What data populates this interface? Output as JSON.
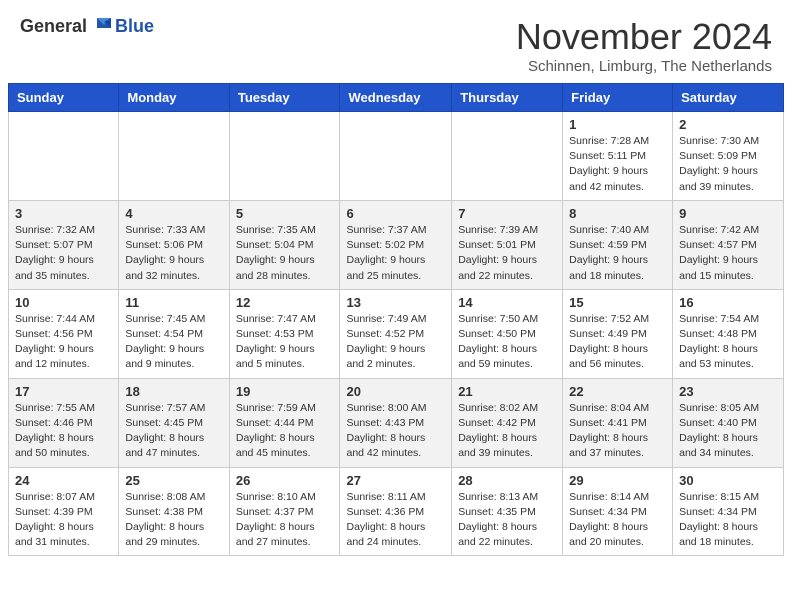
{
  "header": {
    "logo": {
      "general": "General",
      "blue": "Blue"
    },
    "title": "November 2024",
    "subtitle": "Schinnen, Limburg, The Netherlands"
  },
  "columns": [
    "Sunday",
    "Monday",
    "Tuesday",
    "Wednesday",
    "Thursday",
    "Friday",
    "Saturday"
  ],
  "weeks": [
    [
      {
        "day": "",
        "detail": ""
      },
      {
        "day": "",
        "detail": ""
      },
      {
        "day": "",
        "detail": ""
      },
      {
        "day": "",
        "detail": ""
      },
      {
        "day": "",
        "detail": ""
      },
      {
        "day": "1",
        "detail": "Sunrise: 7:28 AM\nSunset: 5:11 PM\nDaylight: 9 hours\nand 42 minutes."
      },
      {
        "day": "2",
        "detail": "Sunrise: 7:30 AM\nSunset: 5:09 PM\nDaylight: 9 hours\nand 39 minutes."
      }
    ],
    [
      {
        "day": "3",
        "detail": "Sunrise: 7:32 AM\nSunset: 5:07 PM\nDaylight: 9 hours\nand 35 minutes."
      },
      {
        "day": "4",
        "detail": "Sunrise: 7:33 AM\nSunset: 5:06 PM\nDaylight: 9 hours\nand 32 minutes."
      },
      {
        "day": "5",
        "detail": "Sunrise: 7:35 AM\nSunset: 5:04 PM\nDaylight: 9 hours\nand 28 minutes."
      },
      {
        "day": "6",
        "detail": "Sunrise: 7:37 AM\nSunset: 5:02 PM\nDaylight: 9 hours\nand 25 minutes."
      },
      {
        "day": "7",
        "detail": "Sunrise: 7:39 AM\nSunset: 5:01 PM\nDaylight: 9 hours\nand 22 minutes."
      },
      {
        "day": "8",
        "detail": "Sunrise: 7:40 AM\nSunset: 4:59 PM\nDaylight: 9 hours\nand 18 minutes."
      },
      {
        "day": "9",
        "detail": "Sunrise: 7:42 AM\nSunset: 4:57 PM\nDaylight: 9 hours\nand 15 minutes."
      }
    ],
    [
      {
        "day": "10",
        "detail": "Sunrise: 7:44 AM\nSunset: 4:56 PM\nDaylight: 9 hours\nand 12 minutes."
      },
      {
        "day": "11",
        "detail": "Sunrise: 7:45 AM\nSunset: 4:54 PM\nDaylight: 9 hours\nand 9 minutes."
      },
      {
        "day": "12",
        "detail": "Sunrise: 7:47 AM\nSunset: 4:53 PM\nDaylight: 9 hours\nand 5 minutes."
      },
      {
        "day": "13",
        "detail": "Sunrise: 7:49 AM\nSunset: 4:52 PM\nDaylight: 9 hours\nand 2 minutes."
      },
      {
        "day": "14",
        "detail": "Sunrise: 7:50 AM\nSunset: 4:50 PM\nDaylight: 8 hours\nand 59 minutes."
      },
      {
        "day": "15",
        "detail": "Sunrise: 7:52 AM\nSunset: 4:49 PM\nDaylight: 8 hours\nand 56 minutes."
      },
      {
        "day": "16",
        "detail": "Sunrise: 7:54 AM\nSunset: 4:48 PM\nDaylight: 8 hours\nand 53 minutes."
      }
    ],
    [
      {
        "day": "17",
        "detail": "Sunrise: 7:55 AM\nSunset: 4:46 PM\nDaylight: 8 hours\nand 50 minutes."
      },
      {
        "day": "18",
        "detail": "Sunrise: 7:57 AM\nSunset: 4:45 PM\nDaylight: 8 hours\nand 47 minutes."
      },
      {
        "day": "19",
        "detail": "Sunrise: 7:59 AM\nSunset: 4:44 PM\nDaylight: 8 hours\nand 45 minutes."
      },
      {
        "day": "20",
        "detail": "Sunrise: 8:00 AM\nSunset: 4:43 PM\nDaylight: 8 hours\nand 42 minutes."
      },
      {
        "day": "21",
        "detail": "Sunrise: 8:02 AM\nSunset: 4:42 PM\nDaylight: 8 hours\nand 39 minutes."
      },
      {
        "day": "22",
        "detail": "Sunrise: 8:04 AM\nSunset: 4:41 PM\nDaylight: 8 hours\nand 37 minutes."
      },
      {
        "day": "23",
        "detail": "Sunrise: 8:05 AM\nSunset: 4:40 PM\nDaylight: 8 hours\nand 34 minutes."
      }
    ],
    [
      {
        "day": "24",
        "detail": "Sunrise: 8:07 AM\nSunset: 4:39 PM\nDaylight: 8 hours\nand 31 minutes."
      },
      {
        "day": "25",
        "detail": "Sunrise: 8:08 AM\nSunset: 4:38 PM\nDaylight: 8 hours\nand 29 minutes."
      },
      {
        "day": "26",
        "detail": "Sunrise: 8:10 AM\nSunset: 4:37 PM\nDaylight: 8 hours\nand 27 minutes."
      },
      {
        "day": "27",
        "detail": "Sunrise: 8:11 AM\nSunset: 4:36 PM\nDaylight: 8 hours\nand 24 minutes."
      },
      {
        "day": "28",
        "detail": "Sunrise: 8:13 AM\nSunset: 4:35 PM\nDaylight: 8 hours\nand 22 minutes."
      },
      {
        "day": "29",
        "detail": "Sunrise: 8:14 AM\nSunset: 4:34 PM\nDaylight: 8 hours\nand 20 minutes."
      },
      {
        "day": "30",
        "detail": "Sunrise: 8:15 AM\nSunset: 4:34 PM\nDaylight: 8 hours\nand 18 minutes."
      }
    ]
  ]
}
